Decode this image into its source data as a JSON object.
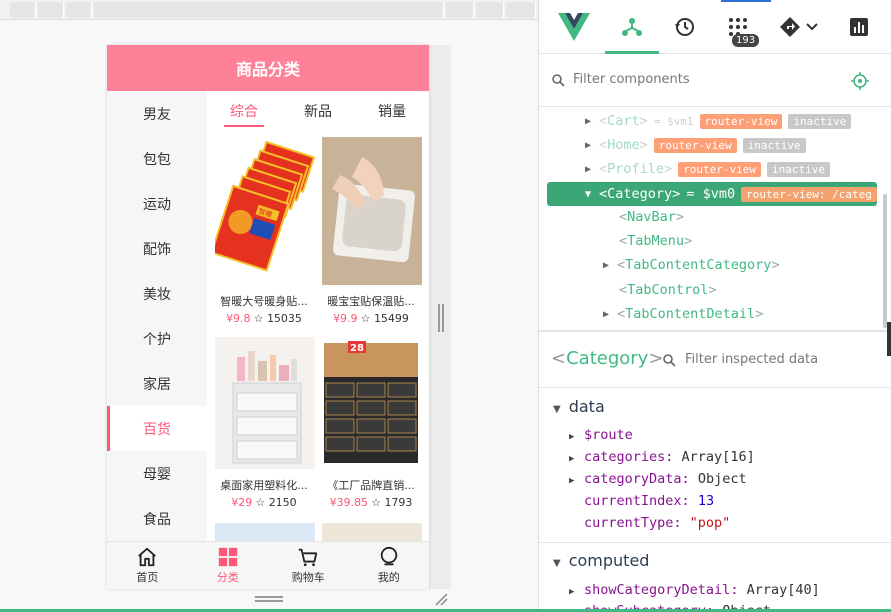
{
  "app": {
    "nav_title": "商品分类",
    "left_menu": [
      "男友",
      "包包",
      "运动",
      "配饰",
      "美妆",
      "个护",
      "家居",
      "百货",
      "母婴",
      "食品"
    ],
    "left_menu_active_index": 7,
    "tabs": [
      "综合",
      "新品",
      "销量"
    ],
    "tabs_active_index": 0,
    "goods": [
      {
        "title": "智暖大号暖身贴...",
        "price": "¥9.8",
        "fav": "15035"
      },
      {
        "title": "暖宝宝贴保温贴...",
        "price": "¥9.9",
        "fav": "15499"
      },
      {
        "title": "桌面家用塑料化...",
        "price": "¥29",
        "fav": "2150"
      },
      {
        "title": "《工厂品牌直销...",
        "price": "¥39.85",
        "fav": "1793"
      }
    ],
    "pack_badge": "28",
    "pack_label": "智暖",
    "tabbar": [
      {
        "label": "首页",
        "icon": "home-icon"
      },
      {
        "label": "分类",
        "icon": "category-icon"
      },
      {
        "label": "购物车",
        "icon": "cart-icon"
      },
      {
        "label": "我的",
        "icon": "profile-icon"
      }
    ],
    "tabbar_active_index": 1
  },
  "devtools": {
    "badge_count": "193",
    "filter_components_placeholder": "Filter components",
    "tree": [
      {
        "name": "Cart",
        "vm": "= $vm1",
        "chips": [
          "router-view",
          "inactive"
        ],
        "dim": true
      },
      {
        "name": "Home",
        "vm": "",
        "chips": [
          "router-view",
          "inactive"
        ],
        "dim": true
      },
      {
        "name": "Profile",
        "vm": "",
        "chips": [
          "router-view",
          "inactive"
        ],
        "dim": true
      },
      {
        "name": "Category",
        "vm": "= $vm0",
        "chips": [
          "router-view: /categ"
        ],
        "selected": true
      },
      {
        "name": "NavBar"
      },
      {
        "name": "TabMenu"
      },
      {
        "name": "TabContentCategory",
        "expandable": true
      },
      {
        "name": "TabControl"
      },
      {
        "name": "TabContentDetail",
        "expandable": true
      }
    ],
    "inspected_component": "Category",
    "filter_inspected_placeholder": "Filter inspected data",
    "sections": {
      "data": "data",
      "computed": "computed"
    },
    "data_props": [
      {
        "key": "$route",
        "value": ""
      },
      {
        "key": "categories",
        "value": "Array[16]"
      },
      {
        "key": "categoryData",
        "value": "Object"
      },
      {
        "key": "currentIndex",
        "value": "13"
      },
      {
        "key": "currentType",
        "value": "\"pop\""
      }
    ],
    "computed_props": [
      {
        "key": "showCategoryDetail",
        "value": "Array[40]"
      },
      {
        "key": "showSubcategory",
        "value": "Object"
      }
    ],
    "accent_color": "#42b983",
    "pink_color": "#ff8198"
  }
}
